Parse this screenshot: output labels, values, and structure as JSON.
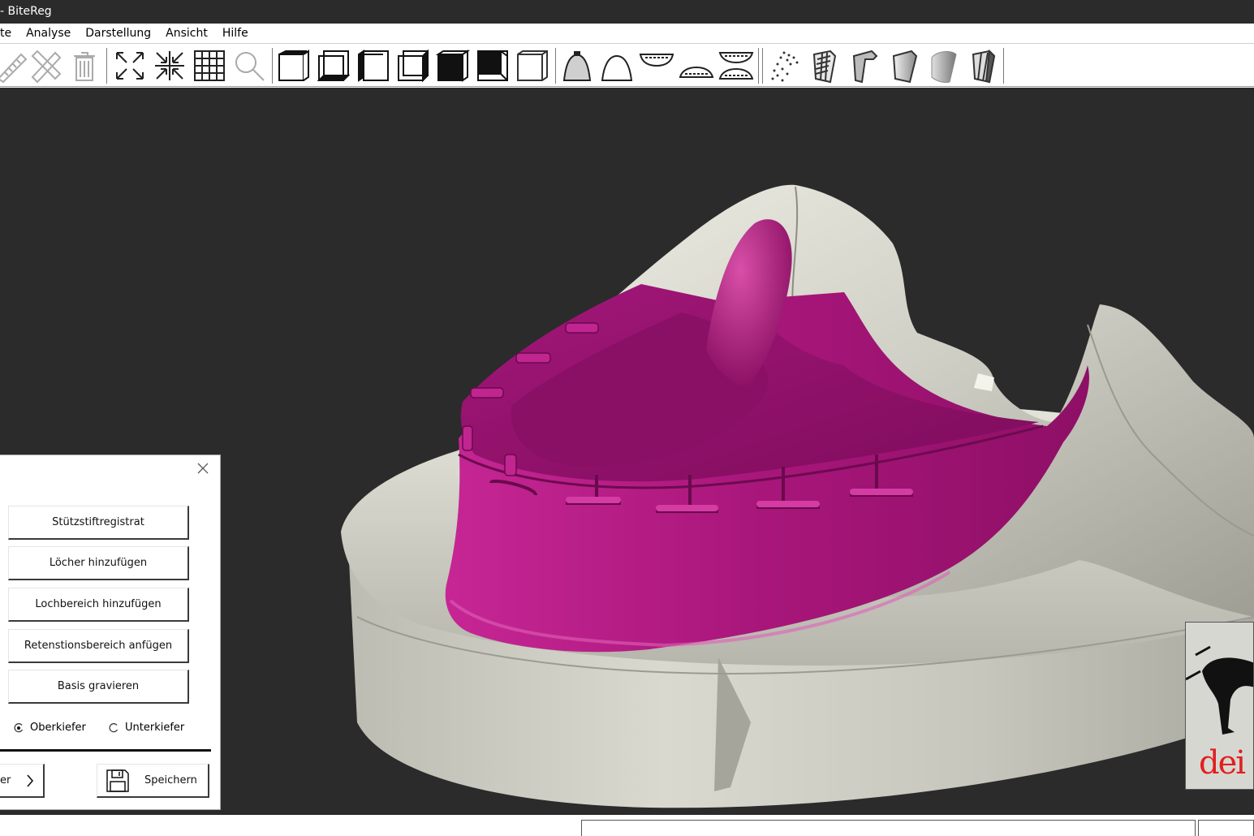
{
  "window": {
    "title": "- BiteReg"
  },
  "menu": {
    "items": [
      "te",
      "Analyse",
      "Darstellung",
      "Ansicht",
      "Hilfe"
    ]
  },
  "toolbar": {
    "icons": [
      "ruler-icon",
      "ruler-delete-icon",
      "trash-icon",
      "zoom-extents-icon",
      "zoom-in-center-icon",
      "grid-icon",
      "magnifier-icon",
      "view-cube-front-icon",
      "view-cube-back-icon",
      "view-cube-left-icon",
      "view-cube-right-icon",
      "view-cube-top-icon",
      "view-cube-bottom-icon",
      "view-cube-iso-icon",
      "jaw-mesh-icon",
      "jaw-shell-icon",
      "upper-jaw-icon",
      "lower-jaw-icon",
      "both-jaws-icon",
      "point-cloud-icon",
      "model-wireframe-icon",
      "model-clip-icon",
      "model-smooth-icon",
      "model-solid-icon",
      "model-section-icon"
    ]
  },
  "panel": {
    "buttons": [
      "Stützstiftregistrat",
      "Löcher hinzufügen",
      "Lochbereich hinzufügen",
      "Retenstionsbereich anfügen",
      "Basis gravieren"
    ],
    "radio": {
      "upper": "Oberkiefer",
      "lower": "Unterkiefer",
      "selected": "upper"
    },
    "next_label": "er",
    "save_label": "Speichern"
  },
  "logo": {
    "text": "dei e"
  },
  "colors": {
    "tray": "#b4197f",
    "model": "#d9d9cf",
    "viewport": "#2b2b2b",
    "titlebar": "#2b2b2b"
  }
}
